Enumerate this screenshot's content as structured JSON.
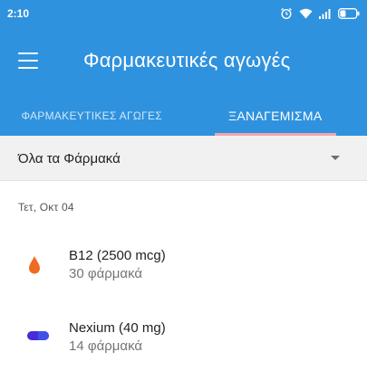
{
  "status_bar": {
    "time": "2:10"
  },
  "app_bar": {
    "title": "Φαρμακευτικές αγωγές"
  },
  "tabs": [
    {
      "label": "ΦΑΡΜΑΚΕΥΤΙΚΕΣ ΑΓΩΓΕΣ",
      "active": false
    },
    {
      "label": "ΞΑΝΑΓΕΜΙΣΜΑ",
      "active": true
    }
  ],
  "filter": {
    "selected": "Όλα τα Φάρμακά"
  },
  "date_header": "Τετ, Οκτ 04",
  "medications": [
    {
      "name": "B12 (2500 mcg)",
      "count": "30 φάρμακά",
      "icon": "drop-icon",
      "color": "#f06a22"
    },
    {
      "name": "Nexium (40 mg)",
      "count": "14 φάρμακά",
      "icon": "capsule-icon",
      "color": "#4a2bd6"
    }
  ],
  "colors": {
    "primary": "#2f92de",
    "tab_indicator": "#f3a4b0",
    "filter_bg": "#f1f1f1"
  }
}
